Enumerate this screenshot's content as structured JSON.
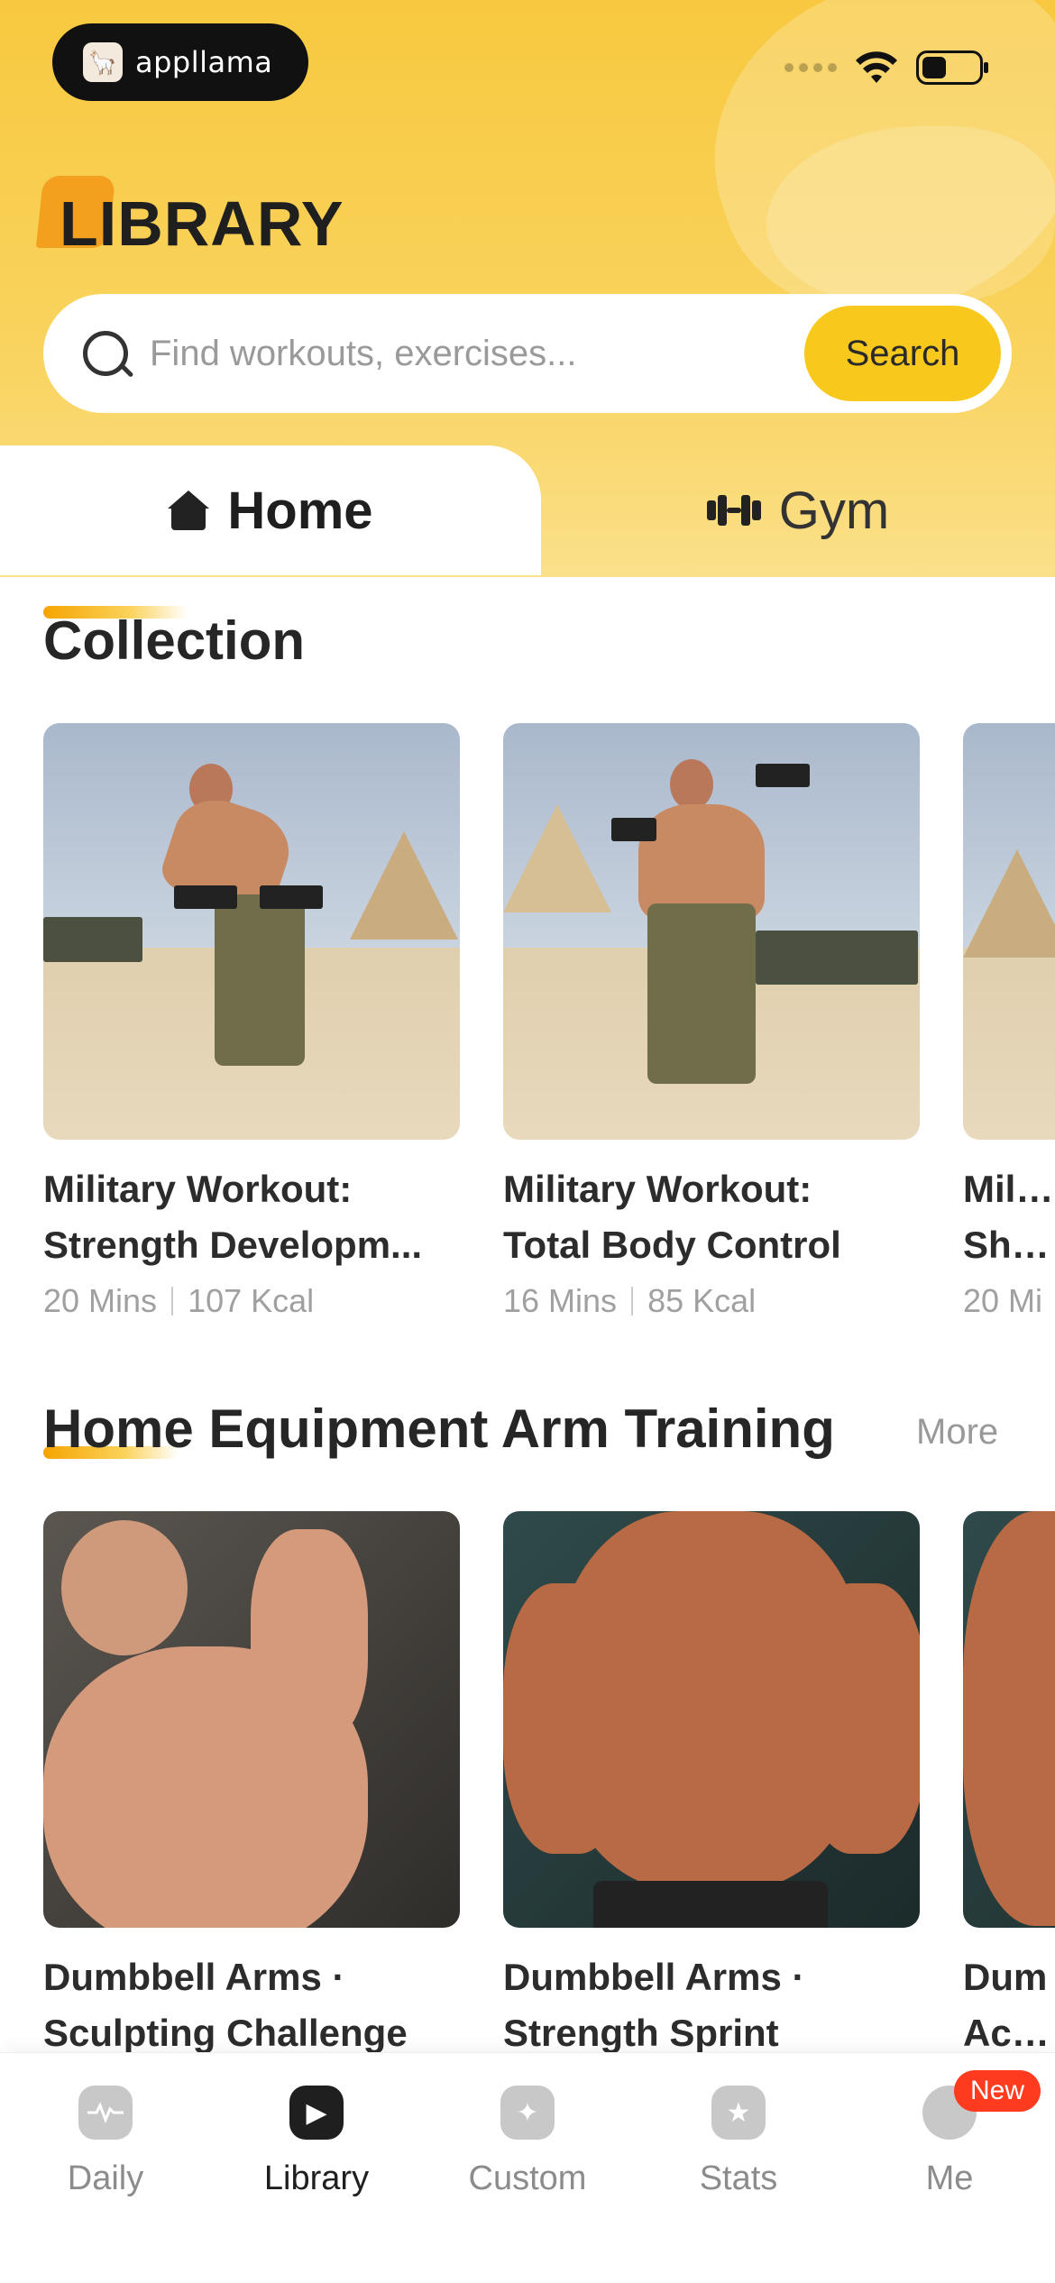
{
  "brand": {
    "name": "appllama"
  },
  "header": {
    "title": "LIBRARY"
  },
  "search": {
    "placeholder": "Find workouts, exercises...",
    "button_label": "Search"
  },
  "tabs": [
    {
      "label": "Home",
      "icon": "home-icon",
      "active": true
    },
    {
      "label": "Gym",
      "icon": "dumbbell-icon",
      "active": false
    }
  ],
  "sections": [
    {
      "title": "Collection",
      "cards": [
        {
          "title_line1": "Military Workout:",
          "title_line2": "Strength Developm...",
          "duration": "20 Mins",
          "kcal": "107 Kcal"
        },
        {
          "title_line1": "Military Workout:",
          "title_line2": "Total Body Control",
          "duration": "16 Mins",
          "kcal": "85 Kcal"
        },
        {
          "title_line1": "Milita",
          "title_line2": "Shou",
          "duration": "20 Mi",
          "kcal": ""
        }
      ]
    },
    {
      "title": "Home Equipment Arm Training",
      "more_label": "More",
      "cards": [
        {
          "title_line1": "Dumbbell Arms ·",
          "title_line2": "Sculpting Challenge"
        },
        {
          "title_line1": "Dumbbell Arms ·",
          "title_line2": "Strength Sprint"
        },
        {
          "title_line1": "Dum",
          "title_line2": "Activ"
        }
      ]
    }
  ],
  "bottom_nav": [
    {
      "label": "Daily",
      "icon": "pulse-icon",
      "active": false
    },
    {
      "label": "Library",
      "icon": "play-icon",
      "active": true
    },
    {
      "label": "Custom",
      "icon": "clipboard-icon",
      "active": false
    },
    {
      "label": "Stats",
      "icon": "star-icon",
      "active": false
    },
    {
      "label": "Me",
      "icon": "profile-icon",
      "active": false,
      "badge": "New"
    }
  ],
  "colors": {
    "accent_yellow": "#f8c81c",
    "header_yellow": "#f8c93f",
    "badge_red": "#ff3b1f"
  }
}
